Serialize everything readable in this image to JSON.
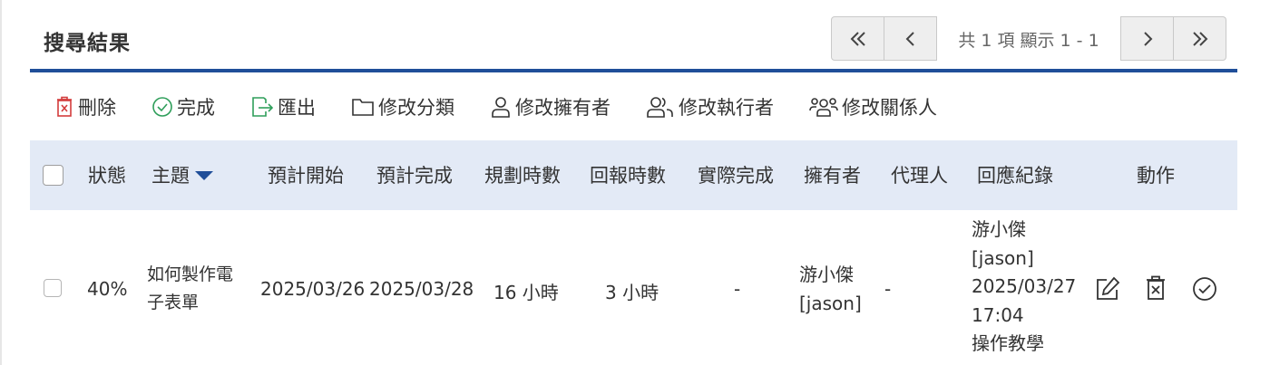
{
  "header": {
    "title": "搜尋結果"
  },
  "pager": {
    "info": "共 1 項 顯示 1 - 1"
  },
  "toolbar": {
    "delete": "刪除",
    "complete": "完成",
    "export": "匯出",
    "edit_category": "修改分類",
    "edit_owner": "修改擁有者",
    "edit_executor": "修改執行者",
    "edit_related": "修改關係人"
  },
  "table": {
    "columns": {
      "status": "狀態",
      "subject": "主題",
      "planned_start": "預計開始",
      "planned_finish": "預計完成",
      "planned_hours": "規劃時數",
      "reported_hours": "回報時數",
      "actual_finish": "實際完成",
      "owner": "擁有者",
      "agent": "代理人",
      "response_log": "回應紀錄",
      "actions": "動作"
    },
    "rows": [
      {
        "status": "40%",
        "subject_line1": "如何製作電",
        "subject_line2": "子表單",
        "planned_start": "2025/03/26",
        "planned_finish": "2025/03/28",
        "planned_hours": "16 小時",
        "reported_hours": "3 小時",
        "actual_finish": "-",
        "owner_name": "游小傑",
        "owner_id": "[jason]",
        "agent": "-",
        "log_name": "游小傑",
        "log_id": "[jason]",
        "log_date": "2025/03/27",
        "log_time": "17:04",
        "log_note": "操作教學"
      }
    ]
  },
  "colors": {
    "accent": "#1f4e99",
    "header_bg": "#e3eaf6",
    "delete_red": "#d33c3c",
    "ok_green": "#2e9e5a"
  }
}
